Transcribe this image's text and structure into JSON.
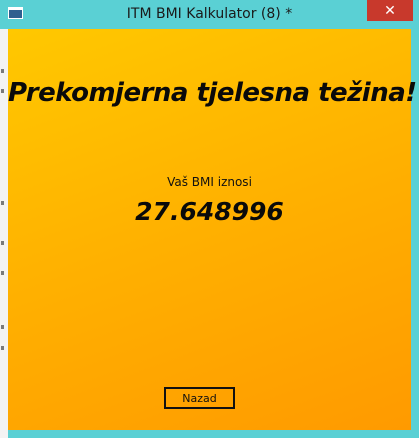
{
  "window": {
    "title": "ITM BMI Kalkulator (8) *",
    "close_glyph": "✕",
    "icon": "app-window-icon"
  },
  "main": {
    "headline": "Prekomjerna tjelesna težina!",
    "bmi_label": "Vaš BMI iznosi",
    "bmi_value": "27.648996",
    "back_button_label": "Nazad"
  },
  "colors": {
    "titlebar": "#5ad0d4",
    "close_button": "#c8392c",
    "gradient_top": "#ffc800",
    "gradient_bottom": "#ff9a00"
  }
}
